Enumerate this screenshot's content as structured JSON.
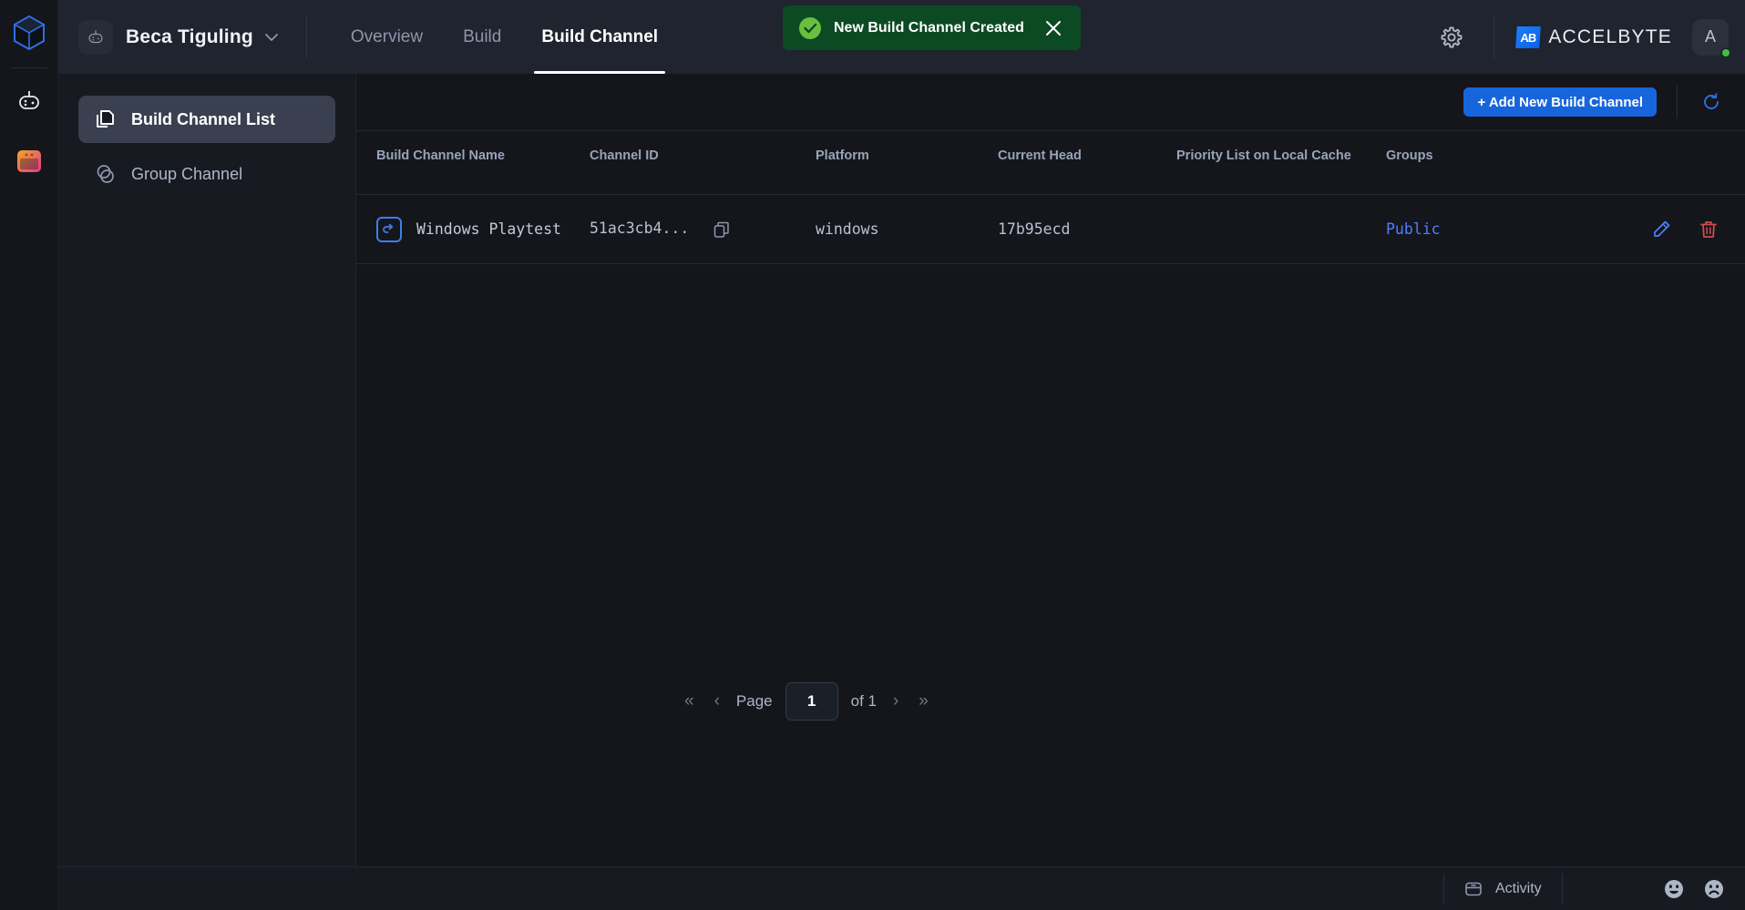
{
  "rail": {
    "logo_icon": "cube-logo-icon",
    "items": [
      {
        "icon": "gamepad-icon",
        "name": "rail-item-game"
      },
      {
        "icon": "window-app-icon",
        "name": "rail-item-launcher"
      }
    ]
  },
  "topbar": {
    "namespace_icon": "gamepad-icon",
    "namespace": "Beca Tiguling",
    "namespace_caret_icon": "chevron-down-icon",
    "tabs": [
      {
        "label": "Overview",
        "active": false
      },
      {
        "label": "Build",
        "active": false
      },
      {
        "label": "Build Channel",
        "active": true
      }
    ],
    "settings_icon": "gear-icon",
    "brand_mark": "AB",
    "brand_name_1": "ACCEL",
    "brand_name_2": "BYTE",
    "avatar_initial": "A",
    "status_icon": "online-dot-icon"
  },
  "toast": {
    "icon": "check-circle-icon",
    "message": "New Build Channel Created",
    "close_icon": "close-icon",
    "bg_color": "#0c4a23",
    "check_color": "#6bbf3f"
  },
  "sidebar": {
    "items": [
      {
        "label": "Build Channel List",
        "icon": "documents-icon",
        "active": true
      },
      {
        "label": "Group Channel",
        "icon": "venn-circles-icon",
        "active": false
      }
    ]
  },
  "toolbar": {
    "add_label": "+ Add New Build Channel",
    "add_color": "#1765dd",
    "refresh_icon": "refresh-icon"
  },
  "table": {
    "columns": [
      "Build Channel Name",
      "Channel ID",
      "Platform",
      "Current Head",
      "Priority List on Local Cache",
      "Groups"
    ],
    "rows": [
      {
        "icon": "channel-arrow-icon",
        "name": "Windows Playtest",
        "channel_id": "51ac3cb4...",
        "copy_icon": "copy-icon",
        "platform": "windows",
        "current_head": "17b95ecd",
        "priority_list": "",
        "groups": "Public",
        "edit_icon": "pencil-icon",
        "delete_icon": "trash-icon"
      }
    ]
  },
  "pagination": {
    "first_icon": "«",
    "prev_icon": "‹",
    "page_label": "Page",
    "page_value": "1",
    "of_label": "of 1",
    "next_icon": "›",
    "last_icon": "»"
  },
  "bottombar": {
    "activity_icon": "panel-icon",
    "activity_label": "Activity",
    "happy_icon": "happy-face-icon",
    "sad_icon": "sad-face-icon"
  }
}
